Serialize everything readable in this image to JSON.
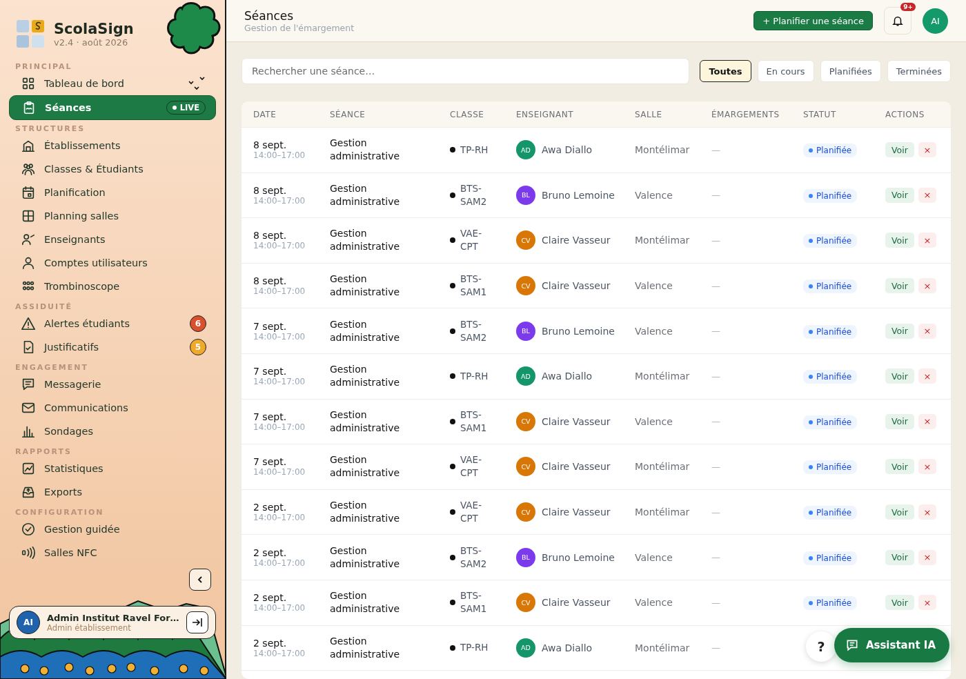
{
  "app": {
    "name": "ScolaSign",
    "version": "v2.4 · août 2026"
  },
  "sidebar": {
    "sections": [
      {
        "title": "PRINCIPAL",
        "items": [
          {
            "label": "Tableau de bord",
            "selected": false
          },
          {
            "label": "Séances",
            "selected": true,
            "tag": "LIVE"
          }
        ]
      },
      {
        "title": "STRUCTURES",
        "items": [
          {
            "label": "Établissements",
            "selected": false
          },
          {
            "label": "Classes & Étudiants",
            "selected": false
          },
          {
            "label": "Planification",
            "selected": false
          },
          {
            "label": "Planning salles",
            "selected": false
          },
          {
            "label": "Enseignants",
            "selected": false
          },
          {
            "label": "Comptes utilisateurs",
            "selected": false
          },
          {
            "label": "Trombinoscope",
            "selected": false
          }
        ]
      },
      {
        "title": "ASSIDUITÉ",
        "items": [
          {
            "label": "Alertes étudiants",
            "selected": false,
            "badge": "6",
            "color": "#d9502f"
          },
          {
            "label": "Justificatifs",
            "selected": false,
            "badge": "5",
            "color": "#f0a92a"
          }
        ]
      },
      {
        "title": "ENGAGEMENT",
        "items": [
          {
            "label": "Messagerie",
            "selected": false
          },
          {
            "label": "Communications",
            "selected": false
          },
          {
            "label": "Sondages",
            "selected": false
          }
        ]
      },
      {
        "title": "RAPPORTS",
        "items": [
          {
            "label": "Statistiques",
            "selected": false
          },
          {
            "label": "Exports",
            "selected": false
          }
        ]
      },
      {
        "title": "CONFIGURATION",
        "items": [
          {
            "label": "Gestion guidée",
            "selected": false
          },
          {
            "label": "Salles NFC",
            "selected": false
          }
        ]
      }
    ],
    "user": {
      "initials": "AI",
      "name": "Admin Institut Ravel For…",
      "role": "Admin établissement"
    }
  },
  "header": {
    "title": "Séances",
    "subtitle": "Gestion de l'émargement",
    "primary_button": "+ Planifier une séance",
    "notification_badge": "9+",
    "avatar": "AI"
  },
  "search": {
    "placeholder": "Rechercher une séance…"
  },
  "filters": [
    {
      "label": "Toutes",
      "selected": true
    },
    {
      "label": "En cours",
      "selected": false
    },
    {
      "label": "Planifiées",
      "selected": false
    },
    {
      "label": "Terminées",
      "selected": false
    }
  ],
  "table": {
    "columns": [
      "DATE",
      "SÉANCE",
      "CLASSE",
      "ENSEIGNANT",
      "SALLE",
      "ÉMARGEMENTS",
      "STATUT",
      "ACTIONS"
    ],
    "rows": [
      {
        "date": "8 sept.",
        "time": "14:00–17:00",
        "session": "Gestion administrative",
        "class": "TP-RH",
        "initials": "AD",
        "teacher": "Awa Diallo",
        "color": "#15966a",
        "room": "Montélimar",
        "signatures": "—",
        "status": "Planifiée",
        "view": "Voir",
        "delete": "×"
      },
      {
        "date": "8 sept.",
        "time": "14:00–17:00",
        "session": "Gestion administrative",
        "class": "BTS-SAM2",
        "initials": "BL",
        "teacher": "Bruno Lemoine",
        "color": "#7c3aed",
        "room": "Valence",
        "signatures": "—",
        "status": "Planifiée",
        "view": "Voir",
        "delete": "×"
      },
      {
        "date": "8 sept.",
        "time": "14:00–17:00",
        "session": "Gestion administrative",
        "class": "VAE-CPT",
        "initials": "CV",
        "teacher": "Claire Vasseur",
        "color": "#d97706",
        "room": "Montélimar",
        "signatures": "—",
        "status": "Planifiée",
        "view": "Voir",
        "delete": "×"
      },
      {
        "date": "8 sept.",
        "time": "14:00–17:00",
        "session": "Gestion administrative",
        "class": "BTS-SAM1",
        "initials": "CV",
        "teacher": "Claire Vasseur",
        "color": "#d97706",
        "room": "Valence",
        "signatures": "—",
        "status": "Planifiée",
        "view": "Voir",
        "delete": "×"
      },
      {
        "date": "7 sept.",
        "time": "14:00–17:00",
        "session": "Gestion administrative",
        "class": "BTS-SAM2",
        "initials": "BL",
        "teacher": "Bruno Lemoine",
        "color": "#7c3aed",
        "room": "Valence",
        "signatures": "—",
        "status": "Planifiée",
        "view": "Voir",
        "delete": "×"
      },
      {
        "date": "7 sept.",
        "time": "14:00–17:00",
        "session": "Gestion administrative",
        "class": "TP-RH",
        "initials": "AD",
        "teacher": "Awa Diallo",
        "color": "#15966a",
        "room": "Montélimar",
        "signatures": "—",
        "status": "Planifiée",
        "view": "Voir",
        "delete": "×"
      },
      {
        "date": "7 sept.",
        "time": "14:00–17:00",
        "session": "Gestion administrative",
        "class": "BTS-SAM1",
        "initials": "CV",
        "teacher": "Claire Vasseur",
        "color": "#d97706",
        "room": "Valence",
        "signatures": "—",
        "status": "Planifiée",
        "view": "Voir",
        "delete": "×"
      },
      {
        "date": "7 sept.",
        "time": "14:00–17:00",
        "session": "Gestion administrative",
        "class": "VAE-CPT",
        "initials": "CV",
        "teacher": "Claire Vasseur",
        "color": "#d97706",
        "room": "Montélimar",
        "signatures": "—",
        "status": "Planifiée",
        "view": "Voir",
        "delete": "×"
      },
      {
        "date": "2 sept.",
        "time": "14:00–17:00",
        "session": "Gestion administrative",
        "class": "VAE-CPT",
        "initials": "CV",
        "teacher": "Claire Vasseur",
        "color": "#d97706",
        "room": "Montélimar",
        "signatures": "—",
        "status": "Planifiée",
        "view": "Voir",
        "delete": "×"
      },
      {
        "date": "2 sept.",
        "time": "14:00–17:00",
        "session": "Gestion administrative",
        "class": "BTS-SAM2",
        "initials": "BL",
        "teacher": "Bruno Lemoine",
        "color": "#7c3aed",
        "room": "Valence",
        "signatures": "—",
        "status": "Planifiée",
        "view": "Voir",
        "delete": "×"
      },
      {
        "date": "2 sept.",
        "time": "14:00–17:00",
        "session": "Gestion administrative",
        "class": "BTS-SAM1",
        "initials": "CV",
        "teacher": "Claire Vasseur",
        "color": "#d97706",
        "room": "Valence",
        "signatures": "—",
        "status": "Planifiée",
        "view": "Voir",
        "delete": "×"
      },
      {
        "date": "2 sept.",
        "time": "14:00–17:00",
        "session": "Gestion administrative",
        "class": "TP-RH",
        "initials": "AD",
        "teacher": "Awa Diallo",
        "color": "#15966a",
        "room": "Montélimar",
        "signatures": "—"
      }
    ]
  },
  "floating": {
    "help": "?",
    "assistant": "Assistant IA"
  }
}
